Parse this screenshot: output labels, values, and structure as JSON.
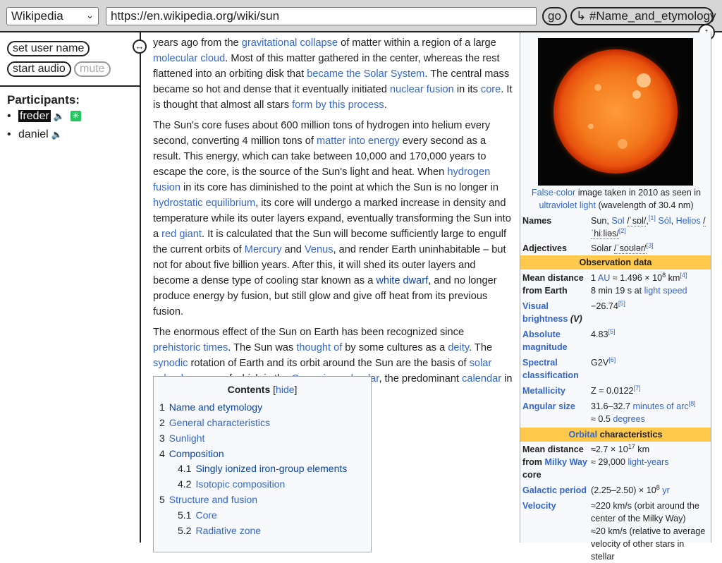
{
  "topbar": {
    "site_select": "Wikipedia",
    "url": "https://en.wikipedia.org/wiki/sun",
    "go_label": "go",
    "anchor_label": "↳ #Name_and_etymology"
  },
  "sidebar": {
    "set_user_name": "set user name",
    "start_audio": "start audio",
    "mute": "mute",
    "participants_title": "Participants:",
    "participants": [
      {
        "name": "freder"
      },
      {
        "name": "daniel"
      }
    ]
  },
  "article": {
    "p1": [
      {
        "t": "years ago from the "
      },
      {
        "t": "gravitational collapse",
        "link": true
      },
      {
        "t": " of matter within a region of a large "
      },
      {
        "t": "molecular cloud",
        "link": true
      },
      {
        "t": ". Most of this matter gathered in the center, whereas the rest flattened into an orbiting disk that "
      },
      {
        "t": "became the Solar System",
        "link": true
      },
      {
        "t": ". The central mass became so hot and dense that it eventually initiated "
      },
      {
        "t": "nuclear fusion",
        "link": true
      },
      {
        "t": " in its "
      },
      {
        "t": "core",
        "link": true
      },
      {
        "t": ". It is thought that almost all stars "
      },
      {
        "t": "form by this process",
        "link": true
      },
      {
        "t": "."
      }
    ],
    "p2": [
      {
        "t": "The Sun's core fuses about 600 million tons of hydrogen into helium every second, converting 4 million tons of "
      },
      {
        "t": "matter into energy",
        "link": true
      },
      {
        "t": " every second as a result. This energy, which can take between 10,000 and 170,000 years to escape the core, is the source of the Sun's light and heat. When "
      },
      {
        "t": "hydrogen fusion",
        "link": true
      },
      {
        "t": " in its core has diminished to the point at which the Sun is no longer in "
      },
      {
        "t": "hydrostatic equilibrium",
        "link": true
      },
      {
        "t": ", its core will undergo a marked increase in density and temperature while its outer layers expand, eventually transforming the Sun into a "
      },
      {
        "t": "red giant",
        "link": true
      },
      {
        "t": ". It is calculated that the Sun will become sufficiently large to engulf the current orbits of "
      },
      {
        "t": "Mercury",
        "link": true
      },
      {
        "t": " and "
      },
      {
        "t": "Venus",
        "link": true
      },
      {
        "t": ", and render Earth uninhabitable – but not for about five billion years. After this, it will shed its outer layers and become a dense type of cooling star known as a "
      },
      {
        "t": "white dwarf",
        "link": true,
        "visited": true
      },
      {
        "t": ", and no longer produce energy by fusion, but still glow and give off heat from its previous fusion."
      }
    ],
    "p3": [
      {
        "t": "The enormous effect of the Sun on Earth has been recognized since "
      },
      {
        "t": "prehistoric times",
        "link": true
      },
      {
        "t": ". The Sun was "
      },
      {
        "t": "thought of",
        "link": true
      },
      {
        "t": " by some cultures as a "
      },
      {
        "t": "deity",
        "link": true
      },
      {
        "t": ". The "
      },
      {
        "t": "synodic",
        "link": true
      },
      {
        "t": " rotation of Earth and its orbit around the Sun are the basis of "
      },
      {
        "t": "solar calendars",
        "link": true
      },
      {
        "t": ", one of which is the "
      },
      {
        "t": "Gregorian calendar",
        "link": true
      },
      {
        "t": ", the predominant "
      },
      {
        "t": "calendar",
        "link": true
      },
      {
        "t": " in use today."
      }
    ]
  },
  "toc": {
    "title": "Contents",
    "hide": "hide",
    "items": [
      {
        "num": "1",
        "label": "Name and etymology",
        "visited": true
      },
      {
        "num": "2",
        "label": "General characteristics"
      },
      {
        "num": "3",
        "label": "Sunlight"
      },
      {
        "num": "4",
        "label": "Composition",
        "visited": true
      },
      {
        "num": "4.1",
        "label": "Singly ionized iron-group elements",
        "visited": true
      },
      {
        "num": "4.2",
        "label": "Isotopic composition"
      },
      {
        "num": "5",
        "label": "Structure and fusion"
      },
      {
        "num": "5.1",
        "label": "Core"
      },
      {
        "num": "5.2",
        "label": "Radiative zone"
      }
    ]
  },
  "infobox": {
    "caption_link1": "False-color",
    "caption_text1": " image taken in 2010 as seen in ",
    "caption_link2": "ultraviolet light",
    "caption_text2": " (wavelength of 30.4 nm)",
    "names_label": "Names",
    "adjectives_label": "Adjectives",
    "adjectives_value": "Solar ",
    "adjectives_ipa": "/ˈsoʊlər/",
    "adjectives_ref": "[3]",
    "obs_header": "Observation data",
    "mean_distance_label": "Mean distance from Earth",
    "mean_distance_value_prefix": "1 ",
    "mean_distance_au": "AU",
    "mean_distance_value_rest": " ≈ 1.496 × 10",
    "mean_distance_exp": "8",
    "mean_distance_unit": " km",
    "mean_distance_ref": "[4]",
    "mean_distance_time": "8 min 19 s at ",
    "mean_distance_light": "light speed",
    "visual_brightness_label": "Visual brightness",
    "visual_brightness_sym": "(V)",
    "visual_brightness_value": "−26.74",
    "visual_brightness_ref": "[5]",
    "absolute_magnitude_label": "Absolute magnitude",
    "absolute_magnitude_value": "4.83",
    "absolute_magnitude_ref": "[5]",
    "spectral_label": "Spectral classification",
    "spectral_value": "G2V",
    "spectral_ref": "[6]",
    "metallicity_label": "Metallicity",
    "metallicity_value": "Z = 0.0122",
    "metallicity_ref": "[7]",
    "angular_label": "Angular size",
    "angular_value": "31.6–32.7 ",
    "angular_link": "minutes of arc",
    "angular_ref": "[8]",
    "angular_value2": "≈ 0.5 ",
    "angular_link2": "degrees",
    "orbital_header_link": "Orbital",
    "orbital_header_text": " characteristics",
    "mw_distance_label_1": "Mean distance from ",
    "mw_distance_label_link": "Milky Way",
    "mw_distance_label_2": " core",
    "mw_distance_value": "≈2.7 × 10",
    "mw_distance_exp": "17",
    "mw_distance_unit": " km",
    "mw_distance_value2": "≈ 29,000 ",
    "mw_distance_ly": "light-years",
    "galactic_label": "Galactic period",
    "galactic_value": "(2.25–2.50) × 10",
    "galactic_exp": "8",
    "galactic_yr": "yr",
    "velocity_label": "Velocity",
    "velocity_value1": "≈220 km/s (orbit around the center of the Milky Way)",
    "velocity_value2": "≈20 km/s (relative to average velocity of other stars in stellar"
  }
}
